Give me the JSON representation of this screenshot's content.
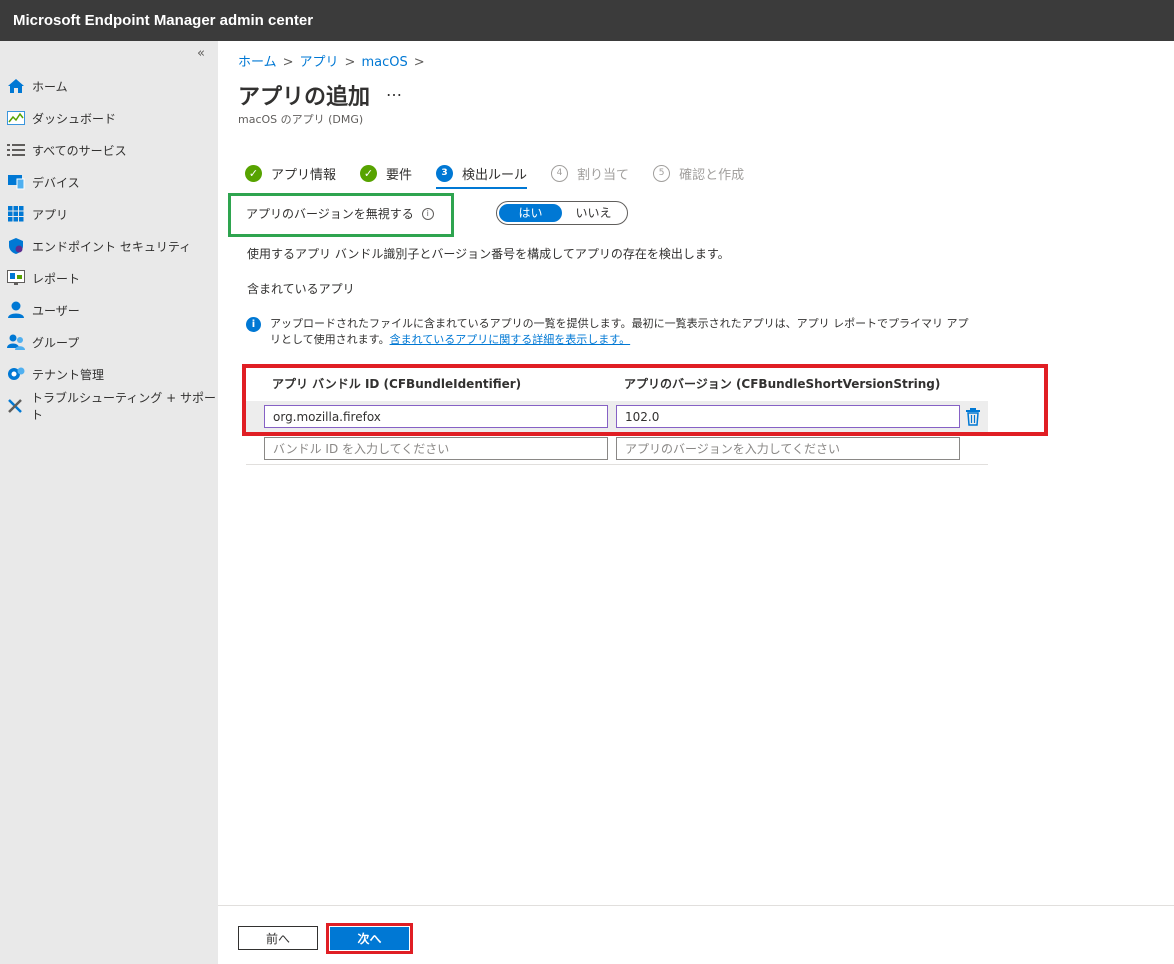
{
  "app": {
    "title": "Microsoft Endpoint Manager admin center"
  },
  "sidebar": {
    "collapse_glyph": "«",
    "items": [
      {
        "label": "ホーム",
        "icon": "home-icon"
      },
      {
        "label": "ダッシュボード",
        "icon": "dashboard-icon"
      },
      {
        "label": "すべてのサービス",
        "icon": "list-icon"
      },
      {
        "label": "デバイス",
        "icon": "device-icon"
      },
      {
        "label": "アプリ",
        "icon": "apps-grid-icon"
      },
      {
        "label": "エンドポイント セキュリティ",
        "icon": "shield-icon"
      },
      {
        "label": "レポート",
        "icon": "report-icon"
      },
      {
        "label": "ユーザー",
        "icon": "user-icon"
      },
      {
        "label": "グループ",
        "icon": "group-icon"
      },
      {
        "label": "テナント管理",
        "icon": "tenant-icon"
      },
      {
        "label": "トラブルシューティング + サポート",
        "icon": "tools-icon"
      }
    ]
  },
  "breadcrumb": [
    "ホーム",
    "アプリ",
    "macOS"
  ],
  "page": {
    "title": "アプリの追加",
    "more": "…",
    "subtitle": "macOS のアプリ (DMG)"
  },
  "steps": [
    {
      "label": "アプリ情報",
      "marker": "✓",
      "state": "done"
    },
    {
      "label": "要件",
      "marker": "✓",
      "state": "done"
    },
    {
      "label": "検出ルール",
      "marker": "3",
      "state": "current"
    },
    {
      "label": "割り当て",
      "marker": "4",
      "state": "future"
    },
    {
      "label": "確認と作成",
      "marker": "5",
      "state": "future"
    }
  ],
  "ignore_version": {
    "label": "アプリのバージョンを無視する",
    "info": "i",
    "yes": "はい",
    "no": "いいえ",
    "selected": "はい"
  },
  "description": "使用するアプリ バンドル識別子とバージョン番号を構成してアプリの存在を検出します。",
  "included_heading": "含まれているアプリ",
  "info": {
    "icon": "i",
    "text": "アップロードされたファイルに含まれているアプリの一覧を提供します。最初に一覧表示されたアプリは、アプリ レポートでプライマリ アプリとして使用されます。",
    "link": "含まれているアプリに関する詳細を表示します。"
  },
  "table": {
    "col_bundle": "アプリ バンドル ID (CFBundleIdentifier)",
    "col_version": "アプリのバージョン (CFBundleShortVersionString)",
    "row": {
      "bundle": "org.mozilla.firefox",
      "version": "102.0"
    },
    "placeholder_bundle": "バンドル ID を入力してください",
    "placeholder_version": "アプリのバージョンを入力してください"
  },
  "footer": {
    "prev": "前へ",
    "next": "次へ"
  },
  "colors": {
    "accent": "#0078d4",
    "done": "#57a300",
    "highlight_red": "#e01e24",
    "highlight_green": "#2ea44f"
  }
}
